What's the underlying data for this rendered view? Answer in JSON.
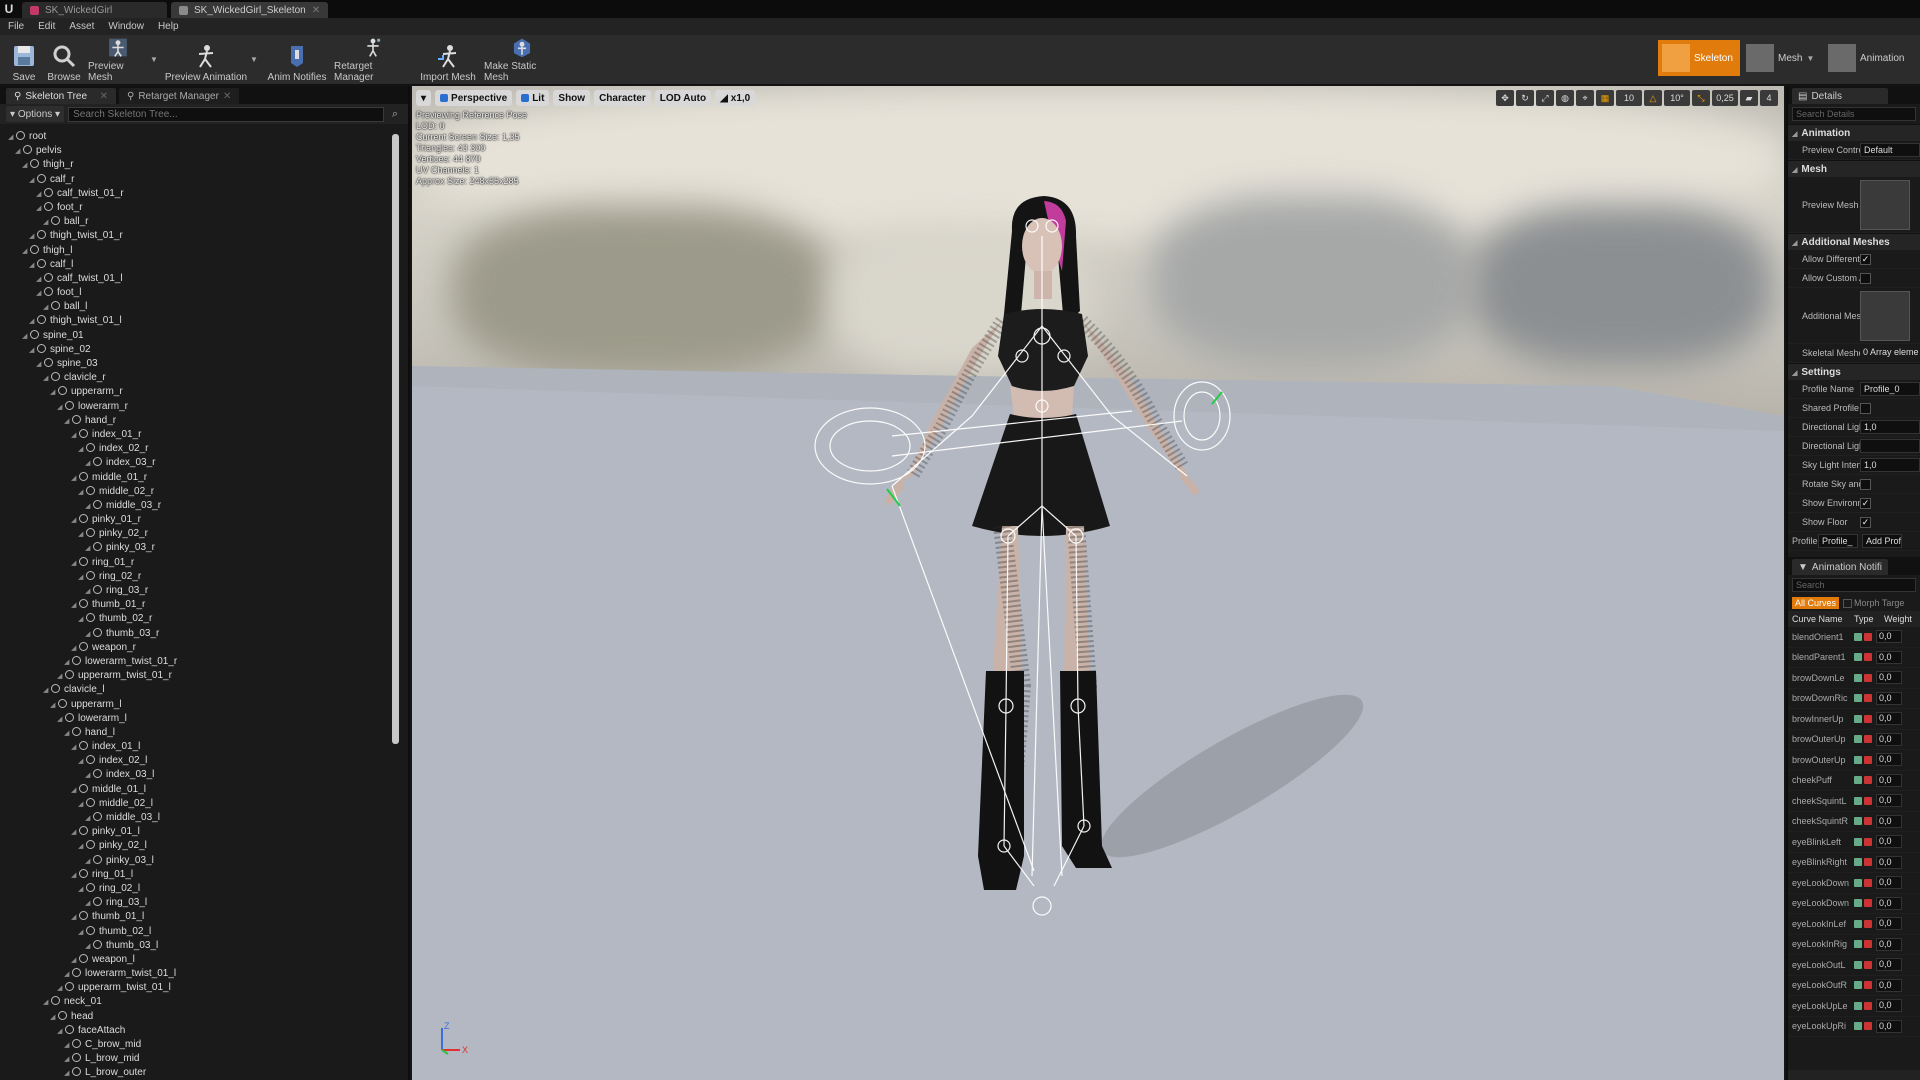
{
  "window": {
    "tabs": [
      {
        "label": "SK_WickedGirl",
        "active": false,
        "color": "#c4396a"
      },
      {
        "label": "SK_WickedGirl_Skeleton",
        "active": true,
        "color": "#8a8a8a"
      }
    ]
  },
  "menu": [
    "File",
    "Edit",
    "Asset",
    "Window",
    "Help"
  ],
  "toolbar": {
    "buttons": [
      "Save",
      "Browse",
      "Preview Mesh",
      "Preview Animation",
      "Anim Notifies",
      "Retarget Manager",
      "Import Mesh",
      "Make Static Mesh"
    ],
    "modes": [
      "Skeleton",
      "Mesh",
      "Animation"
    ]
  },
  "left_panel": {
    "tabs": [
      "Skeleton Tree",
      "Retarget Manager"
    ],
    "options_label": "Options",
    "search_placeholder": "Search Skeleton Tree...",
    "bones": [
      {
        "name": "root",
        "depth": 0
      },
      {
        "name": "pelvis",
        "depth": 1
      },
      {
        "name": "thigh_r",
        "depth": 2
      },
      {
        "name": "calf_r",
        "depth": 3
      },
      {
        "name": "calf_twist_01_r",
        "depth": 4
      },
      {
        "name": "foot_r",
        "depth": 4
      },
      {
        "name": "ball_r",
        "depth": 5
      },
      {
        "name": "thigh_twist_01_r",
        "depth": 3
      },
      {
        "name": "thigh_l",
        "depth": 2
      },
      {
        "name": "calf_l",
        "depth": 3
      },
      {
        "name": "calf_twist_01_l",
        "depth": 4
      },
      {
        "name": "foot_l",
        "depth": 4
      },
      {
        "name": "ball_l",
        "depth": 5
      },
      {
        "name": "thigh_twist_01_l",
        "depth": 3
      },
      {
        "name": "spine_01",
        "depth": 2
      },
      {
        "name": "spine_02",
        "depth": 3
      },
      {
        "name": "spine_03",
        "depth": 4
      },
      {
        "name": "clavicle_r",
        "depth": 5
      },
      {
        "name": "upperarm_r",
        "depth": 6
      },
      {
        "name": "lowerarm_r",
        "depth": 7
      },
      {
        "name": "hand_r",
        "depth": 8
      },
      {
        "name": "index_01_r",
        "depth": 9
      },
      {
        "name": "index_02_r",
        "depth": 10
      },
      {
        "name": "index_03_r",
        "depth": 11
      },
      {
        "name": "middle_01_r",
        "depth": 9
      },
      {
        "name": "middle_02_r",
        "depth": 10
      },
      {
        "name": "middle_03_r",
        "depth": 11
      },
      {
        "name": "pinky_01_r",
        "depth": 9
      },
      {
        "name": "pinky_02_r",
        "depth": 10
      },
      {
        "name": "pinky_03_r",
        "depth": 11
      },
      {
        "name": "ring_01_r",
        "depth": 9
      },
      {
        "name": "ring_02_r",
        "depth": 10
      },
      {
        "name": "ring_03_r",
        "depth": 11
      },
      {
        "name": "thumb_01_r",
        "depth": 9
      },
      {
        "name": "thumb_02_r",
        "depth": 10
      },
      {
        "name": "thumb_03_r",
        "depth": 11
      },
      {
        "name": "weapon_r",
        "depth": 9
      },
      {
        "name": "lowerarm_twist_01_r",
        "depth": 8
      },
      {
        "name": "upperarm_twist_01_r",
        "depth": 7
      },
      {
        "name": "clavicle_l",
        "depth": 5
      },
      {
        "name": "upperarm_l",
        "depth": 6
      },
      {
        "name": "lowerarm_l",
        "depth": 7
      },
      {
        "name": "hand_l",
        "depth": 8
      },
      {
        "name": "index_01_l",
        "depth": 9
      },
      {
        "name": "index_02_l",
        "depth": 10
      },
      {
        "name": "index_03_l",
        "depth": 11
      },
      {
        "name": "middle_01_l",
        "depth": 9
      },
      {
        "name": "middle_02_l",
        "depth": 10
      },
      {
        "name": "middle_03_l",
        "depth": 11
      },
      {
        "name": "pinky_01_l",
        "depth": 9
      },
      {
        "name": "pinky_02_l",
        "depth": 10
      },
      {
        "name": "pinky_03_l",
        "depth": 11
      },
      {
        "name": "ring_01_l",
        "depth": 9
      },
      {
        "name": "ring_02_l",
        "depth": 10
      },
      {
        "name": "ring_03_l",
        "depth": 11
      },
      {
        "name": "thumb_01_l",
        "depth": 9
      },
      {
        "name": "thumb_02_l",
        "depth": 10
      },
      {
        "name": "thumb_03_l",
        "depth": 11
      },
      {
        "name": "weapon_l",
        "depth": 9
      },
      {
        "name": "lowerarm_twist_01_l",
        "depth": 8
      },
      {
        "name": "upperarm_twist_01_l",
        "depth": 7
      },
      {
        "name": "neck_01",
        "depth": 5
      },
      {
        "name": "head",
        "depth": 6
      },
      {
        "name": "faceAttach",
        "depth": 7
      },
      {
        "name": "C_brow_mid",
        "depth": 8
      },
      {
        "name": "L_brow_mid",
        "depth": 8
      },
      {
        "name": "L_brow_outer",
        "depth": 8
      }
    ]
  },
  "viewport": {
    "toolbar": [
      "Perspective",
      "Lit",
      "Show",
      "Character",
      "LOD Auto",
      "x1,0"
    ],
    "right_controls": [
      "10",
      "10°",
      "0,25",
      "4"
    ],
    "stats": [
      "Previewing Reference Pose",
      "LOD: 0",
      "Current Screen Size: 1,35",
      "Triangles: 43 300",
      "Vertices: 44 870",
      "UV Channels: 1",
      "Approx Size: 248x55x285"
    ],
    "axis_labels": [
      "Z",
      "X"
    ]
  },
  "details": {
    "tab_label": "Details",
    "search_placeholder": "Search Details",
    "sections": [
      {
        "title": "Animation",
        "props": [
          {
            "name": "Preview Contro",
            "value": "Default",
            "kind": "field"
          }
        ]
      },
      {
        "title": "Mesh",
        "props": [
          {
            "name": "Preview Mesh (Skeleton)",
            "value": "",
            "kind": "thumb"
          }
        ]
      },
      {
        "title": "Additional Meshes",
        "props": [
          {
            "name": "Allow Different",
            "value": "✓",
            "kind": "check"
          },
          {
            "name": "Allow Custom A",
            "value": "",
            "kind": "check"
          },
          {
            "name": "Additional Mes",
            "value": "",
            "kind": "thumb"
          },
          {
            "name": "Skeletal Meshe",
            "value": "0 Array eleme",
            "kind": "plain"
          }
        ]
      },
      {
        "title": "Settings",
        "props": [
          {
            "name": "Profile Name",
            "value": "Profile_0",
            "kind": "field"
          },
          {
            "name": "Shared Profile",
            "value": "",
            "kind": "check"
          },
          {
            "name": "Directional Ligh",
            "value": "1,0",
            "kind": "field"
          },
          {
            "name": "Directional Ligh",
            "value": "",
            "kind": "field"
          },
          {
            "name": "Sky Light Inten",
            "value": "1,0",
            "kind": "field"
          },
          {
            "name": "Rotate Sky and",
            "value": "",
            "kind": "check"
          },
          {
            "name": "Show Environm",
            "value": "✓",
            "kind": "check"
          },
          {
            "name": "Show Floor",
            "value": "✓",
            "kind": "check"
          }
        ]
      }
    ],
    "profile_label": "Profile",
    "profile_select": "Profile_",
    "add_profile": "Add Profi"
  },
  "curves": {
    "tab_label": "Animation Notifi",
    "search_placeholder": "Search",
    "filter_all": "All Curves",
    "filter_morph": "Morph Targe",
    "headers": [
      "Curve Name",
      "Type",
      "Weight"
    ],
    "rows": [
      {
        "name": "blendOrient1",
        "weight": "0,0"
      },
      {
        "name": "blendParent1",
        "weight": "0,0"
      },
      {
        "name": "browDownLe",
        "weight": "0,0"
      },
      {
        "name": "browDownRic",
        "weight": "0,0"
      },
      {
        "name": "browInnerUp",
        "weight": "0,0"
      },
      {
        "name": "browOuterUp",
        "weight": "0,0"
      },
      {
        "name": "browOuterUp",
        "weight": "0,0"
      },
      {
        "name": "cheekPuff",
        "weight": "0,0"
      },
      {
        "name": "cheekSquintL",
        "weight": "0,0"
      },
      {
        "name": "cheekSquintR",
        "weight": "0,0"
      },
      {
        "name": "eyeBlinkLeft",
        "weight": "0,0"
      },
      {
        "name": "eyeBlinkRight",
        "weight": "0,0"
      },
      {
        "name": "eyeLookDown",
        "weight": "0,0"
      },
      {
        "name": "eyeLookDown",
        "weight": "0,0"
      },
      {
        "name": "eyeLookInLef",
        "weight": "0,0"
      },
      {
        "name": "eyeLookInRig",
        "weight": "0,0"
      },
      {
        "name": "eyeLookOutL",
        "weight": "0,0"
      },
      {
        "name": "eyeLookOutR",
        "weight": "0,0"
      },
      {
        "name": "eyeLookUpLe",
        "weight": "0,0"
      },
      {
        "name": "eyeLookUpRi",
        "weight": "0,0"
      }
    ]
  },
  "colors": {
    "accent": "#e07b0c",
    "panel": "#1a1a1a",
    "toolbar": "#2c2c2c"
  }
}
